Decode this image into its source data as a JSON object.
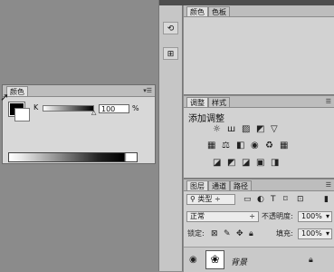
{
  "color_panel": {
    "tab": "颜色",
    "channel_label": "K",
    "value": "100",
    "unit": "%",
    "menu_icon": "panel-menu-icon"
  },
  "dock_strip": {
    "buttons": [
      "history-icon",
      "properties-icon"
    ]
  },
  "color_dock": {
    "tabs": [
      "颜色",
      "色板"
    ]
  },
  "adjustments": {
    "tabs": [
      "调整",
      "样式"
    ],
    "heading": "添加调整",
    "icons_row1": [
      "brightness-icon",
      "levels-icon",
      "curves-icon",
      "exposure-icon",
      "vibrance-icon"
    ],
    "icons_row2": [
      "hue-saturation-icon",
      "color-balance-icon",
      "black-white-icon",
      "photo-filter-icon",
      "channel-mixer-icon",
      "color-lookup-icon"
    ],
    "icons_row3": [
      "invert-icon",
      "posterize-icon",
      "threshold-icon",
      "selective-color-icon",
      "gradient-map-icon"
    ]
  },
  "layers": {
    "tabs": [
      "图层",
      "通道",
      "路径"
    ],
    "filter_label": "类型",
    "blend_mode": "正常",
    "opacity_label": "不透明度:",
    "opacity_value": "100%",
    "lock_label": "锁定:",
    "fill_label": "填充:",
    "fill_value": "100%",
    "layer_name": "背景"
  }
}
